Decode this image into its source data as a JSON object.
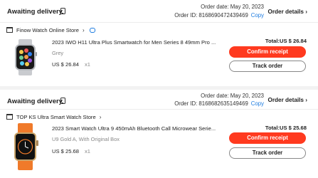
{
  "orders": [
    {
      "status": "Awaiting delivery",
      "order_date": "Order date: May 20, 2023",
      "order_id": "Order ID: 8168690472439469",
      "copy_label": "Copy",
      "details_label": "Order details",
      "store_name": "Finow Watch Online Store",
      "product_title": "2023 IWO H11 Ultra Plus Smartwatch for Men Series 8 49mm Pro ...",
      "variant": "Grey",
      "price": "US $ 26.84",
      "quantity": "x1",
      "total": "Total:US $ 26.84",
      "confirm_label": "Confirm receipt",
      "track_label": "Track order",
      "thumbnail": "smartwatch-grey-thumbnail"
    },
    {
      "status": "Awaiting delivery",
      "order_date": "Order date: May 20, 2023",
      "order_id": "Order ID: 8168682635149469",
      "copy_label": "Copy",
      "details_label": "Order details",
      "store_name": "TOP KS Ultra Smart Watch Store",
      "product_title": "2023 Smart Watch Ultra 9 450mAh Bluetooth Call Microwear Serie...",
      "variant": "U9 Gold A, With Original Box",
      "price": "US $ 25.68",
      "quantity": "x1",
      "total": "Total:US $ 25.68",
      "confirm_label": "Confirm receipt",
      "track_label": "Track order",
      "thumbnail": "smartwatch-orange-thumbnail"
    }
  ],
  "colors": {
    "accent": "#ff3a1f",
    "link": "#1c7be0",
    "muted": "#888888"
  },
  "icons": [
    "phone-icon",
    "store-icon",
    "chevron-right-icon",
    "chat-icon",
    "chevron-right-icon"
  ]
}
